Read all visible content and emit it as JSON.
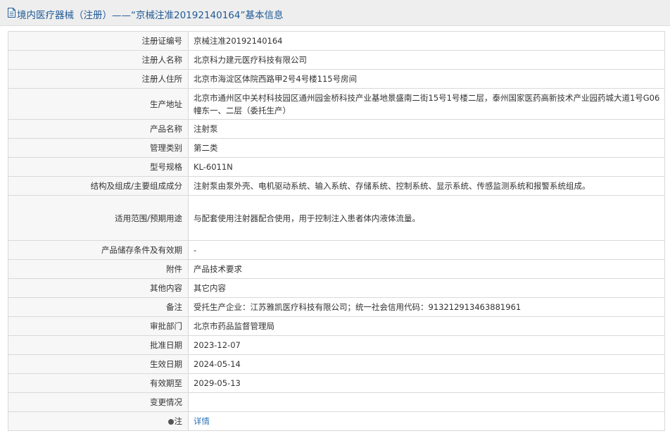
{
  "header": {
    "title": "境内医疗器械（注册）——“京械注准20192140164”基本信息",
    "icon": "document-icon"
  },
  "rows": [
    {
      "label": "注册证编号",
      "value": "京械注准20192140164"
    },
    {
      "label": "注册人名称",
      "value": "北京科力建元医疗科技有限公司"
    },
    {
      "label": "注册人住所",
      "value": "北京市海淀区体院西路甲2号4号楼115号房间"
    },
    {
      "label": "生产地址",
      "value": "北京市通州区中关村科技园区通州园金桥科技产业基地景盛南二街15号1号楼二层，泰州国家医药高新技术产业园药城大道1号G06幢东一、二层（委托生产）"
    },
    {
      "label": "产品名称",
      "value": "注射泵"
    },
    {
      "label": "管理类别",
      "value": "第二类"
    },
    {
      "label": "型号规格",
      "value": "KL-6011N"
    },
    {
      "label": "结构及组成/主要组成成分",
      "value": "注射泵由泵外壳、电机驱动系统、输入系统、存储系统、控制系统、显示系统、传感监测系统和报警系统组成。"
    },
    {
      "label": "适用范围/预期用途",
      "value": "与配套使用注射器配合使用，用于控制注入患者体内液体流量。"
    },
    {
      "label": "产品储存条件及有效期",
      "value": "-"
    },
    {
      "label": "附件",
      "value": "产品技术要求"
    },
    {
      "label": "其他内容",
      "value": "其它内容"
    },
    {
      "label": "备注",
      "value": "受托生产企业：江苏雅凯医疗科技有限公司；统一社会信用代码：913212913463881961"
    },
    {
      "label": "审批部门",
      "value": "北京市药品监督管理局"
    },
    {
      "label": "批准日期",
      "value": "2023-12-07"
    },
    {
      "label": "生效日期",
      "value": "2024-05-14"
    },
    {
      "label": "有效期至",
      "value": "2029-05-13"
    },
    {
      "label": "变更情况",
      "value": ""
    }
  ],
  "note": {
    "label": "注",
    "link": "详情",
    "icon": "note-icon"
  },
  "colors": {
    "title": "#1f5a96",
    "link": "#2a71b8",
    "label_bg": "#f7f7f7",
    "border": "#d9d9d9"
  }
}
